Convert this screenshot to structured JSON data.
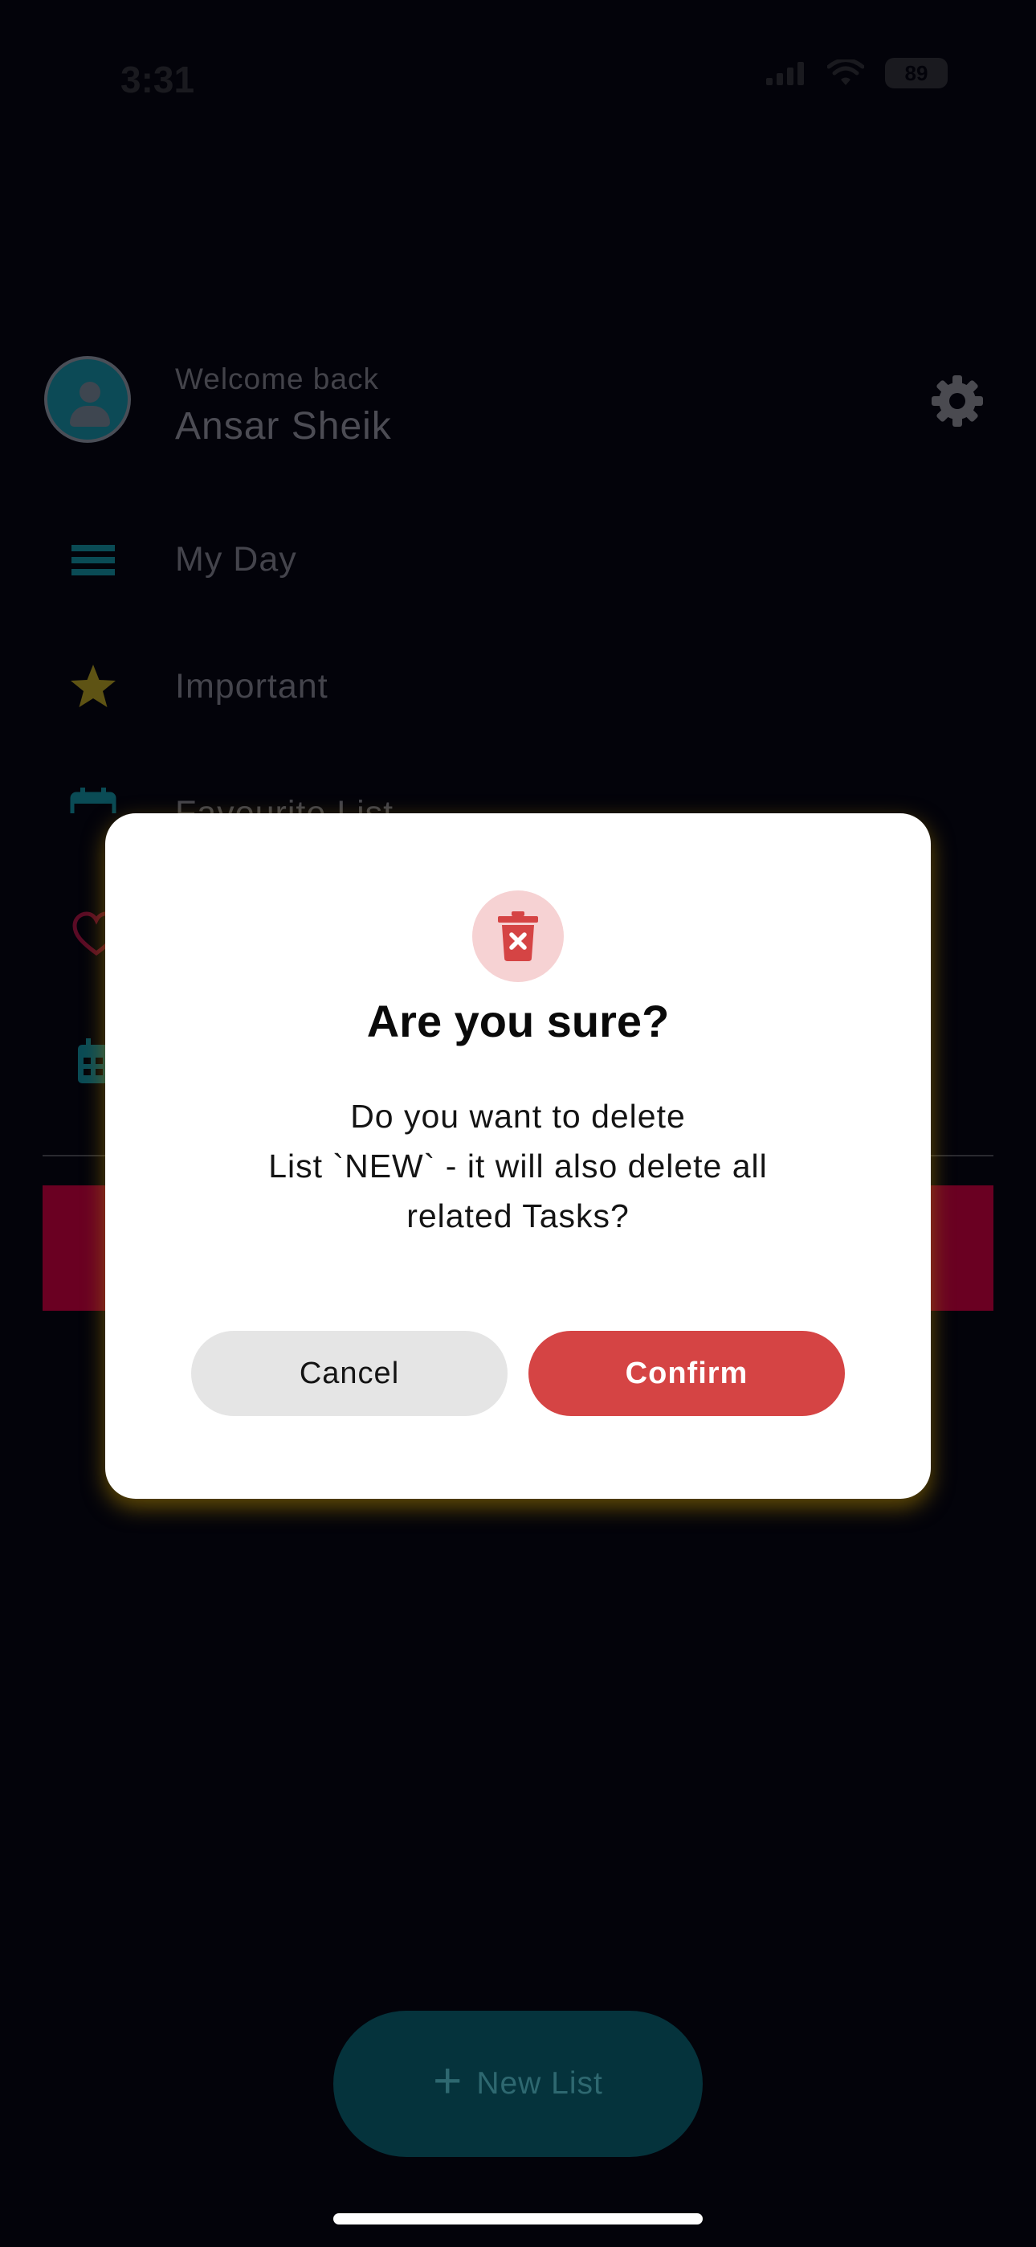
{
  "status_bar": {
    "time": "3:31",
    "battery": "89"
  },
  "drawer": {
    "welcome": "Welcome back",
    "user_name": "Ansar Sheik",
    "items": [
      {
        "label": "My Day",
        "icon": "list-icon"
      },
      {
        "label": "Important",
        "icon": "star-icon"
      },
      {
        "label": "Favourite List",
        "icon": "calendar-icon"
      },
      {
        "label": "",
        "icon": "heart-icon"
      },
      {
        "label": "",
        "icon": "calendar-grid-icon"
      }
    ],
    "new_list_label": "New List"
  },
  "dialog": {
    "title": "Are you sure?",
    "message_lines": [
      "Do you want to delete",
      "List `NEW` - it will also delete all",
      "related Tasks?"
    ],
    "cancel_label": "Cancel",
    "confirm_label": "Confirm"
  },
  "colors": {
    "background": "#03030a",
    "confirm": "#d54444",
    "cancel": "#e5e5e5",
    "icon_bg": "#f6d2d3",
    "fab": "#05333c",
    "accent_red_band": "#6a0022"
  }
}
